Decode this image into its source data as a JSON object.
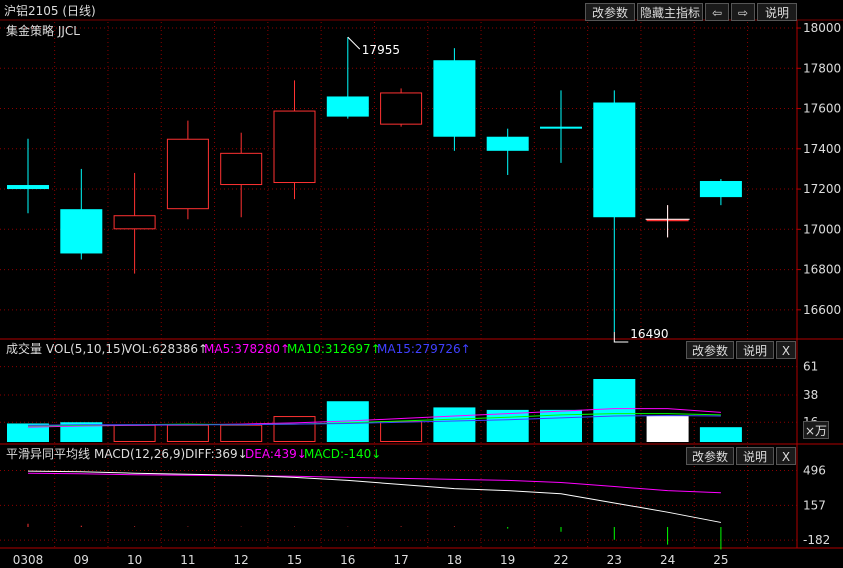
{
  "header": {
    "title": "沪铝2105 (日线)",
    "buttons": [
      "改参数",
      "隐藏主指标",
      "⇦",
      "⇨",
      "说明"
    ]
  },
  "main_panel": {
    "indicator_name": "集金策略 JJCL"
  },
  "volume_panel": {
    "name": "成交量",
    "params": "VOL(5,10,15)",
    "vol": "VOL:628386↑",
    "ma5": "MA5:378280↑",
    "ma10": "MA10:312697↑",
    "ma15": "MA15:279726↑",
    "buttons": [
      "改参数",
      "说明",
      "X"
    ],
    "unit_button": "×万"
  },
  "macd_panel": {
    "name": "平滑异同平均线",
    "params": "MACD(12,26,9)",
    "diff": "DIFF:369↓",
    "dea": "DEA:439↓",
    "macd": "MACD:-140↓",
    "buttons": [
      "改参数",
      "说明",
      "X"
    ]
  },
  "colors": {
    "up": "#ff3232",
    "down": "#00ffff",
    "ma5": "#ff00ff",
    "ma10": "#00ff00",
    "ma15": "#4040ff",
    "diff": "#ffffff",
    "dea": "#ff00ff",
    "grid": "#8b0000",
    "text": "#dddddd"
  },
  "chart_data": {
    "type": "candlestick",
    "categories": [
      "0308",
      "09",
      "10",
      "11",
      "12",
      "15",
      "16",
      "17",
      "18",
      "19",
      "22",
      "23",
      "24",
      "25"
    ],
    "x_tick_labels": [
      "0308",
      "09",
      "10",
      "11",
      "12",
      "15",
      "16",
      "17",
      "18",
      "19",
      "22",
      "23",
      "24",
      "25"
    ],
    "candles": [
      {
        "open": 17220,
        "close": 17200,
        "high": 17450,
        "low": 17080
      },
      {
        "open": 17100,
        "close": 16880,
        "high": 17300,
        "low": 16850
      },
      {
        "open": 17000,
        "close": 17070,
        "high": 17280,
        "low": 16780
      },
      {
        "open": 17100,
        "close": 17450,
        "high": 17540,
        "low": 17050
      },
      {
        "open": 17220,
        "close": 17380,
        "high": 17480,
        "low": 17060
      },
      {
        "open": 17230,
        "close": 17590,
        "high": 17740,
        "low": 17150
      },
      {
        "open": 17660,
        "close": 17560,
        "high": 17955,
        "low": 17550
      },
      {
        "open": 17520,
        "close": 17680,
        "high": 17700,
        "low": 17510
      },
      {
        "open": 17840,
        "close": 17460,
        "high": 17900,
        "low": 17390
      },
      {
        "open": 17460,
        "close": 17390,
        "high": 17500,
        "low": 17270
      },
      {
        "open": 17510,
        "close": 17500,
        "high": 17690,
        "low": 17330
      },
      {
        "open": 17630,
        "close": 17060,
        "high": 17690,
        "low": 16490
      },
      {
        "open": 17050,
        "close": 17050,
        "high": 17120,
        "low": 16960
      },
      {
        "open": 17240,
        "close": 17160,
        "high": 17250,
        "low": 17120
      }
    ],
    "y_ticks": [
      16600,
      16800,
      17000,
      17200,
      17400,
      17600,
      17800,
      18000
    ],
    "ylim": [
      16460,
      18030
    ],
    "annotations": [
      {
        "label": "17955",
        "value": 17955,
        "index": 6
      },
      {
        "label": "16490",
        "value": 16490,
        "index": 11
      }
    ],
    "volume": {
      "values": [
        15,
        16,
        14,
        14,
        14,
        21,
        33,
        17,
        28,
        26,
        26,
        51,
        21,
        12
      ],
      "ma5": [
        12,
        13,
        13.5,
        14,
        14.5,
        15.5,
        17,
        19,
        21,
        23,
        25,
        27,
        27,
        24
      ],
      "ma10": [
        13,
        13.5,
        14,
        14.5,
        14,
        14.5,
        15.5,
        17,
        18.5,
        20,
        22,
        23,
        23,
        22
      ],
      "ma15": [
        13.5,
        14,
        14,
        14,
        14,
        14.5,
        15,
        16,
        17,
        18,
        19.5,
        21,
        21.5,
        21
      ],
      "y_ticks": [
        16,
        38,
        61
      ],
      "ylim": [
        0,
        68
      ]
    },
    "macd": {
      "diff": [
        490,
        485,
        470,
        460,
        450,
        430,
        400,
        360,
        320,
        300,
        270,
        180,
        90,
        -10
      ],
      "dea": [
        470,
        465,
        455,
        450,
        445,
        440,
        430,
        420,
        410,
        400,
        380,
        340,
        300,
        280
      ],
      "hist": [
        20,
        8,
        4,
        3,
        2,
        2,
        2,
        4,
        4,
        -10,
        -30,
        -80,
        -110,
        -140
      ],
      "y_ticks": [
        -182,
        157,
        496
      ],
      "ylim": [
        -230,
        560
      ]
    }
  }
}
